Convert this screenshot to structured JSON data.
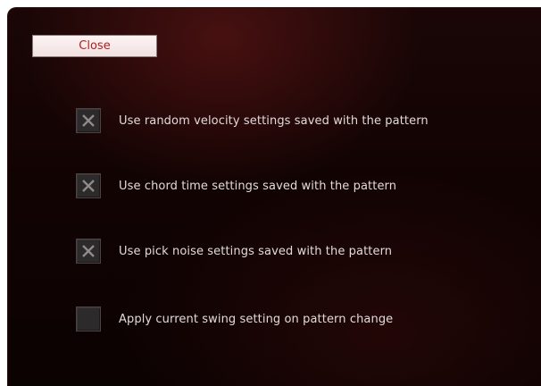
{
  "dialog": {
    "close_label": "Close"
  },
  "options": [
    {
      "label": "Use random velocity settings saved with the pattern",
      "checked": true
    },
    {
      "label": "Use chord time settings saved with the pattern",
      "checked": true
    },
    {
      "label": "Use pick noise settings saved with the pattern",
      "checked": true
    },
    {
      "label": "Apply current swing setting on pattern change",
      "checked": false
    }
  ],
  "colors": {
    "panel_background": "#120303",
    "close_text": "#b02020",
    "label_text": "#e2dada",
    "checkbox_fill": "#2c2a2a"
  }
}
